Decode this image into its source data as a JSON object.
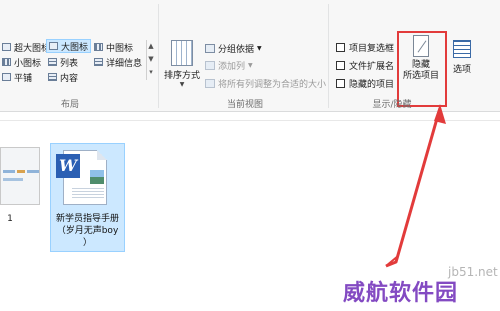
{
  "ribbon": {
    "layout": {
      "group_label": "布局",
      "items": {
        "extra_large": "超大图标",
        "large": "大图标",
        "medium": "中图标",
        "small": "小图标",
        "list": "列表",
        "details": "详细信息",
        "tiles": "平铺",
        "content": "内容"
      },
      "selected": "large"
    },
    "current_view": {
      "group_label": "当前视图",
      "sort_by": "排序方式",
      "group_by": "分组依据",
      "add_columns": "添加列",
      "size_all_columns": "将所有列调整为合适的大小"
    },
    "show_hide": {
      "group_label": "显示/隐藏",
      "item_checkboxes": "项目复选框",
      "file_extensions": "文件扩展名",
      "hidden_items": "隐藏的项目",
      "hide_selected_line1": "隐藏",
      "hide_selected_line2": "所选项目",
      "options": "选项",
      "highlight_color": "#e23b3b"
    }
  },
  "files": [
    {
      "name": "1",
      "selected": false
    },
    {
      "name_line1": "新学员指导手册",
      "name_line2": "（岁月无声boy",
      "name_line3": "）",
      "selected": true,
      "icon": "word-document-icon"
    }
  ],
  "colors": {
    "selection_bg": "#cce8ff",
    "selection_border": "#99d1ff",
    "arrow": "#e23b3b"
  },
  "watermarks": {
    "site": "jb51.net",
    "brand": "威航软件园"
  }
}
